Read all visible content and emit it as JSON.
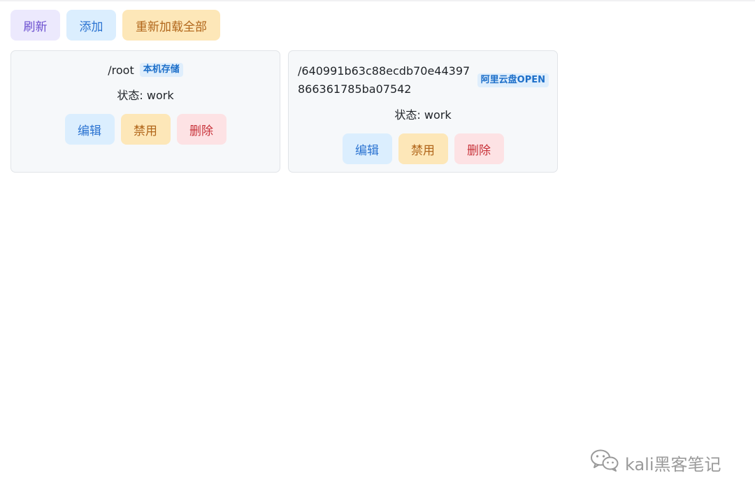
{
  "toolbar": {
    "refresh_label": "刷新",
    "add_label": "添加",
    "reload_all_label": "重新加载全部"
  },
  "cards": [
    {
      "path": "/root",
      "tag": "本机存储",
      "status": "状态: work",
      "edit_label": "编辑",
      "disable_label": "禁用",
      "delete_label": "删除"
    },
    {
      "path": "/640991b63c88ecdb70e44397866361785ba07542",
      "tag": "阿里云盘OPEN",
      "status": "状态: work",
      "edit_label": "编辑",
      "disable_label": "禁用",
      "delete_label": "删除"
    }
  ],
  "watermark": {
    "icon": "wechat-icon",
    "text": "kali黑客笔记"
  }
}
